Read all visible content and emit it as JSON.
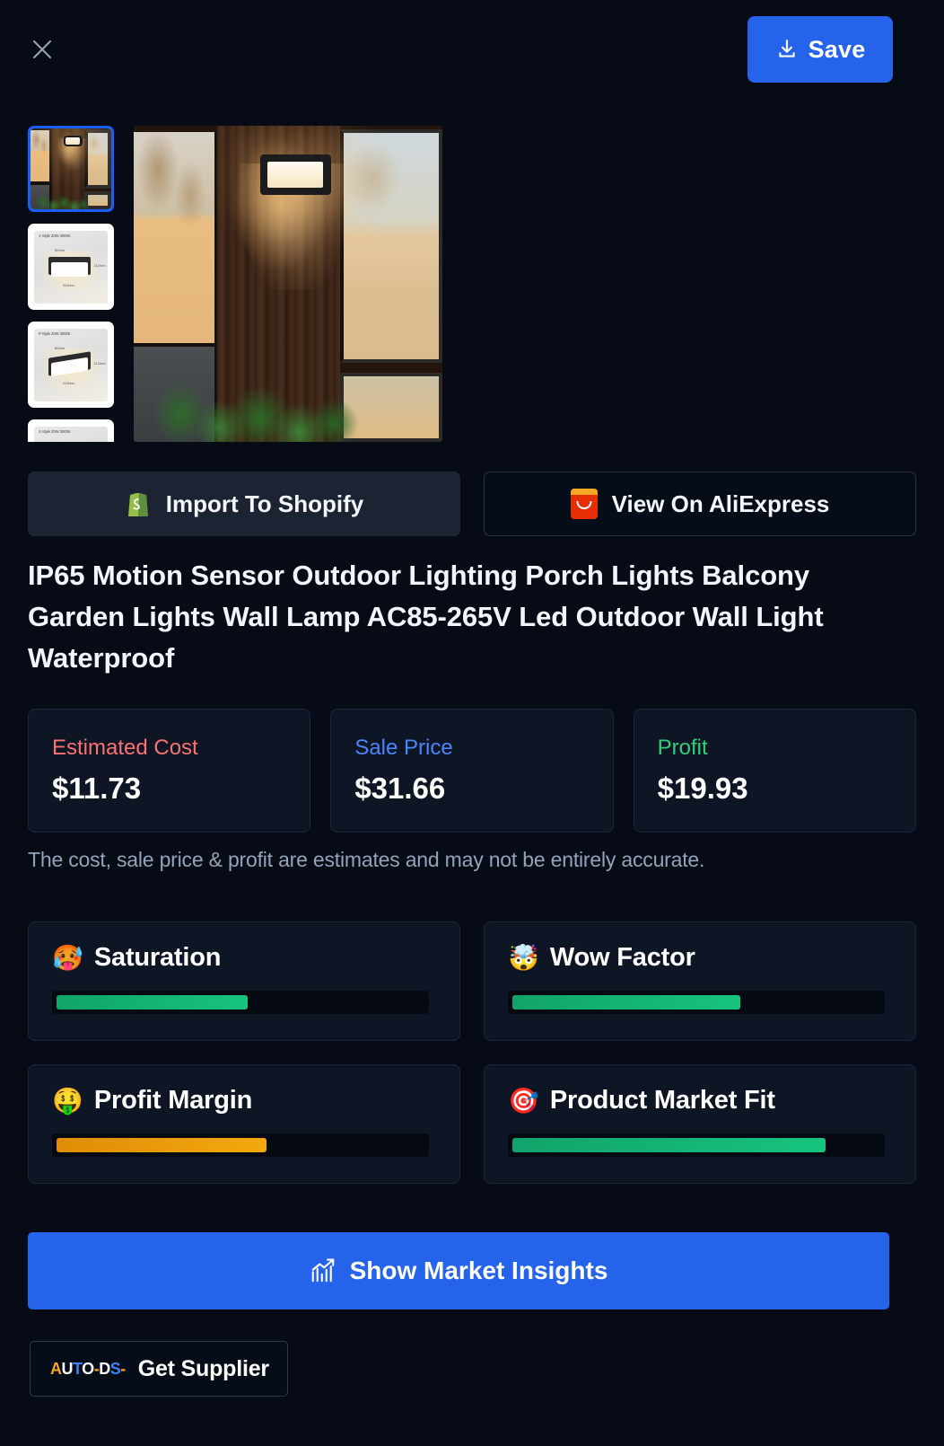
{
  "header": {
    "close_icon": "close-icon",
    "save_label": "Save",
    "save_icon": "download-icon",
    "save_color": "#2563eb"
  },
  "gallery": {
    "thumbnails": [
      {
        "alt": "Outdoor wall lamp mounted on wooden siding at dusk",
        "type": "photo",
        "selected": true
      },
      {
        "alt": "V Style 20W 3000K dimension diagram",
        "type": "diagram",
        "caption": "V Style 20W 3000K",
        "selected": false
      },
      {
        "alt": "P Style 20W 3000K dimension diagram",
        "type": "diagram",
        "caption": "P Style 20W 3000K",
        "selected": false
      },
      {
        "alt": "S Style 20W 3000K dimension diagram",
        "type": "diagram",
        "caption": "S Style 20W 3000K",
        "selected": false
      }
    ],
    "main_image_alt": "Outdoor LED wall lamp lit on dark wood cladding between frosted glass panels"
  },
  "actions": {
    "shopify": {
      "label": "Import To Shopify",
      "icon": "shopify-bag-icon"
    },
    "aliexpress": {
      "label": "View On AliExpress",
      "icon": "aliexpress-icon"
    }
  },
  "product": {
    "title": "IP65 Motion Sensor Outdoor Lighting Porch Lights Balcony Garden Lights Wall Lamp AC85-265V Led Outdoor Wall Light Waterproof"
  },
  "pricing": {
    "cards": [
      {
        "label": "Estimated Cost",
        "value": "$11.73",
        "label_color": "#f87272"
      },
      {
        "label": "Sale Price",
        "value": "$31.66",
        "label_color": "#4a86f7"
      },
      {
        "label": "Profit",
        "value": "$19.93",
        "label_color": "#2fd07a"
      }
    ],
    "disclaimer": "The cost, sale price & profit are estimates and may not be entirely accurate."
  },
  "metrics": [
    {
      "emoji": "🥵",
      "icon": "hot-face-icon",
      "label": "Saturation",
      "percent": 52,
      "color": "green"
    },
    {
      "emoji": "🤯",
      "icon": "exploding-head-icon",
      "label": "Wow Factor",
      "percent": 62,
      "color": "green"
    },
    {
      "emoji": "🤑",
      "icon": "money-face-icon",
      "label": "Profit Margin",
      "percent": 57,
      "color": "orange"
    },
    {
      "emoji": "🎯",
      "icon": "target-icon",
      "label": "Product Market Fit",
      "percent": 85,
      "color": "green"
    }
  ],
  "footer": {
    "insights_label": "Show Market Insights",
    "insights_icon": "chart-trend-icon",
    "supplier_label": "Get Supplier",
    "supplier_logo": "AUTO-DS-"
  }
}
